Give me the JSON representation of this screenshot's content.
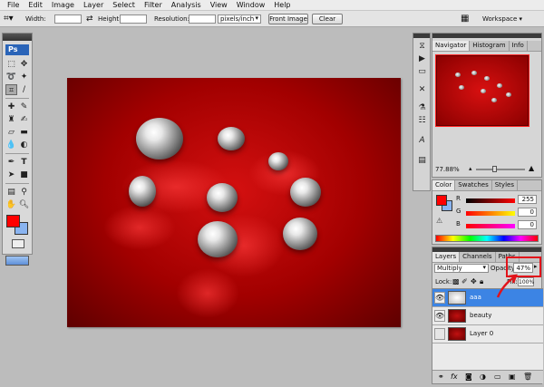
{
  "menu": {
    "items": [
      "File",
      "Edit",
      "Image",
      "Layer",
      "Select",
      "Filter",
      "Analysis",
      "View",
      "Window",
      "Help"
    ]
  },
  "options": {
    "width_label": "Width:",
    "height_label": "Height:",
    "resolution_label": "Resolution:",
    "units_value": "pixels/inch",
    "front_image_label": "Front Image",
    "clear_label": "Clear",
    "workspace_label": "Workspace ▾"
  },
  "tools": {
    "logo": "Ps",
    "type_glyph": "T"
  },
  "navigator": {
    "tabs": [
      "Navigator",
      "Histogram",
      "Info"
    ],
    "zoom": "77.88%"
  },
  "color_panel": {
    "tabs": [
      "Color",
      "Swatches",
      "Styles"
    ],
    "r_label": "R",
    "g_label": "G",
    "b_label": "B",
    "r_value": "255",
    "g_value": "0",
    "b_value": "0",
    "colors": {
      "foreground": "#ff0000",
      "background": "#8ab4f0"
    }
  },
  "layers_panel": {
    "tabs": [
      "Layers",
      "Channels",
      "Paths"
    ],
    "blend_mode": "Multiply",
    "opacity_label": "Opacity:",
    "opacity_value": "47%",
    "lock_label": "Lock:",
    "fill_label": "Fill:",
    "fill_value": "100%",
    "layers": [
      {
        "name": "aaa",
        "selected": true
      },
      {
        "name": "beauty",
        "selected": false
      },
      {
        "name": "Layer 0",
        "selected": false
      }
    ]
  }
}
